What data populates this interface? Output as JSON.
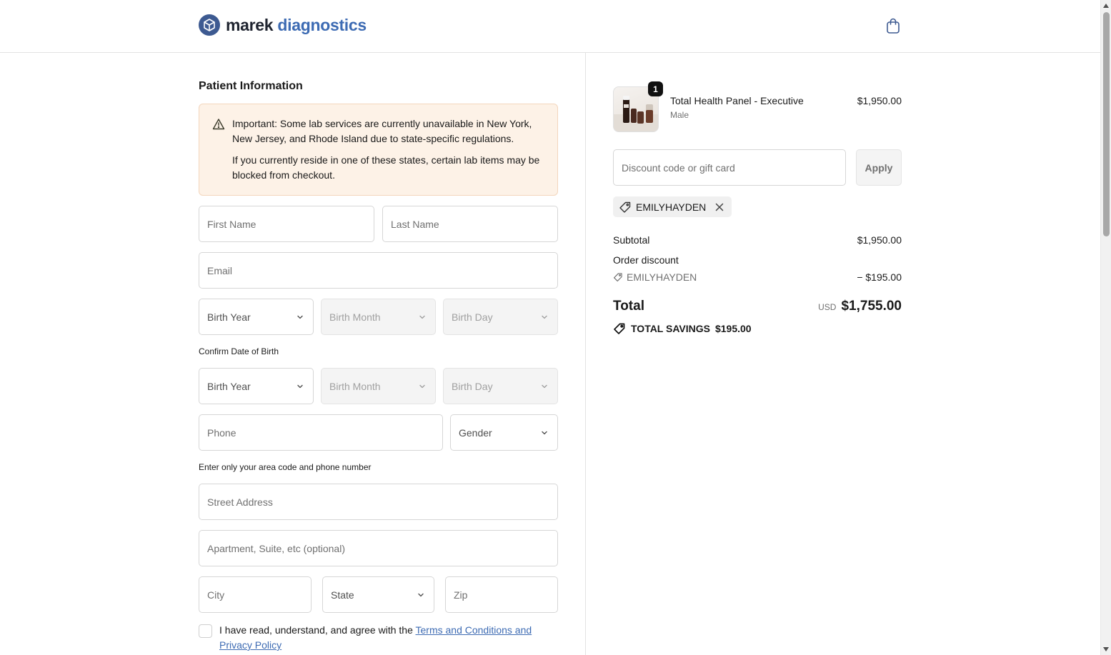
{
  "brand": {
    "name_part1": "marek",
    "name_part2": "diagnostics",
    "primary_color": "#3d5a91",
    "accent_color": "#3d6bb3"
  },
  "header": {
    "cart_icon": "shopping-bag-icon"
  },
  "form": {
    "title": "Patient Information",
    "notice": {
      "icon": "warning-triangle-icon",
      "line1": "Important: Some lab services are currently unavailable in New York, New Jersey, and Rhode Island due to state-specific regulations.",
      "line2": "If you currently reside in one of these states, certain lab items may be blocked from checkout."
    },
    "first_name_placeholder": "First Name",
    "last_name_placeholder": "Last Name",
    "email_placeholder": "Email",
    "birth_year": "Birth Year",
    "birth_month": "Birth Month",
    "birth_day": "Birth Day",
    "confirm_dob_label": "Confirm Date of Birth",
    "confirm_birth_year": "Birth Year",
    "confirm_birth_month": "Birth Month",
    "confirm_birth_day": "Birth Day",
    "phone_placeholder": "Phone",
    "gender": "Gender",
    "phone_helper": "Enter only your area code and phone number",
    "street_placeholder": "Street Address",
    "apartment_placeholder": "Apartment, Suite, etc (optional)",
    "city_placeholder": "City",
    "state": "State",
    "zip_placeholder": "Zip",
    "agree_prefix": "I have read, understand, and agree with the ",
    "agree_link": "Terms and Conditions and Privacy Policy"
  },
  "order": {
    "item": {
      "quantity": "1",
      "name": "Total Health Panel - Executive",
      "variant": "Male",
      "price": "$1,950.00"
    },
    "discount_placeholder": "Discount code or gift card",
    "apply_label": "Apply",
    "applied_code": "EMILYHAYDEN",
    "subtotal_label": "Subtotal",
    "subtotal_value": "$1,950.00",
    "order_discount_label": "Order discount",
    "discount_code": "EMILYHAYDEN",
    "discount_value": "− $195.00",
    "total_label": "Total",
    "currency": "USD",
    "total_value": "$1,755.00",
    "savings_label": "TOTAL SAVINGS",
    "savings_value": "$195.00"
  }
}
